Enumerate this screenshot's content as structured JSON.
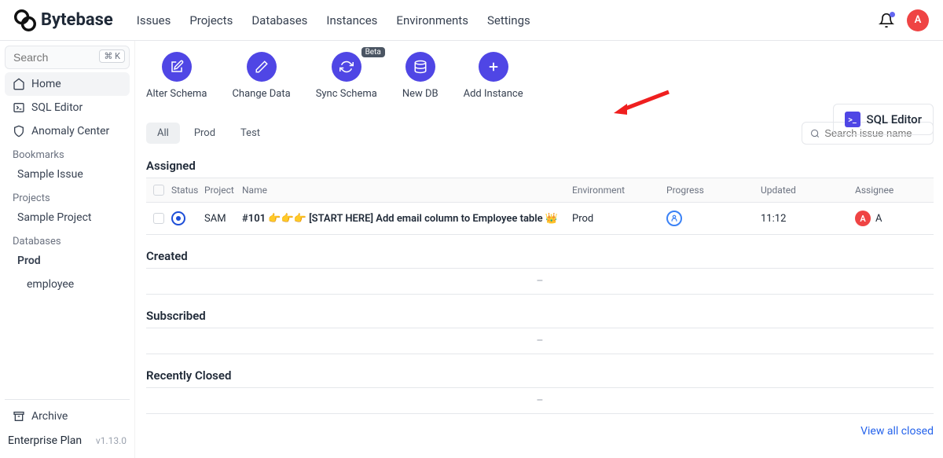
{
  "brand": "Bytebase",
  "nav": [
    "Issues",
    "Projects",
    "Databases",
    "Instances",
    "Environments",
    "Settings"
  ],
  "user": {
    "initial": "A"
  },
  "sidebar": {
    "search_placeholder": "Search",
    "kbd": "⌘ K",
    "primary": [
      {
        "label": "Home",
        "icon": "home"
      },
      {
        "label": "SQL Editor",
        "icon": "terminal"
      },
      {
        "label": "Anomaly Center",
        "icon": "shield"
      }
    ],
    "bookmarks_label": "Bookmarks",
    "bookmarks": [
      "Sample Issue"
    ],
    "projects_label": "Projects",
    "projects": [
      "Sample Project"
    ],
    "databases_label": "Databases",
    "databases": [
      {
        "label": "Prod",
        "strong": true
      },
      {
        "label": "employee",
        "strong": false
      }
    ],
    "archive_label": "Archive",
    "plan": "Enterprise Plan",
    "version": "v1.13.0"
  },
  "actions": [
    {
      "label": "Alter Schema",
      "icon": "edit",
      "beta": false
    },
    {
      "label": "Change Data",
      "icon": "pencil",
      "beta": false
    },
    {
      "label": "Sync Schema",
      "icon": "sync",
      "beta": true,
      "beta_label": "Beta"
    },
    {
      "label": "New DB",
      "icon": "db",
      "beta": false
    },
    {
      "label": "Add Instance",
      "icon": "plus",
      "beta": false
    }
  ],
  "sql_editor_button": "SQL Editor",
  "tabs": [
    "All",
    "Prod",
    "Test"
  ],
  "active_tab": 0,
  "issue_search_placeholder": "Search issue name",
  "columns": {
    "status": "Status",
    "project": "Project",
    "name": "Name",
    "environment": "Environment",
    "progress": "Progress",
    "updated": "Updated",
    "assignee": "Assignee"
  },
  "sections": {
    "assigned": "Assigned",
    "created": "Created",
    "subscribed": "Subscribed",
    "recently_closed": "Recently Closed"
  },
  "issues": [
    {
      "project": "SAM",
      "name": "#101 👉👉👉 [START HERE] Add email column to Employee table 👑",
      "environment": "Prod",
      "updated": "11:12",
      "assignee_initial": "A",
      "assignee_name": "A"
    }
  ],
  "empty_placeholder": "–",
  "view_all_closed": "View all closed"
}
